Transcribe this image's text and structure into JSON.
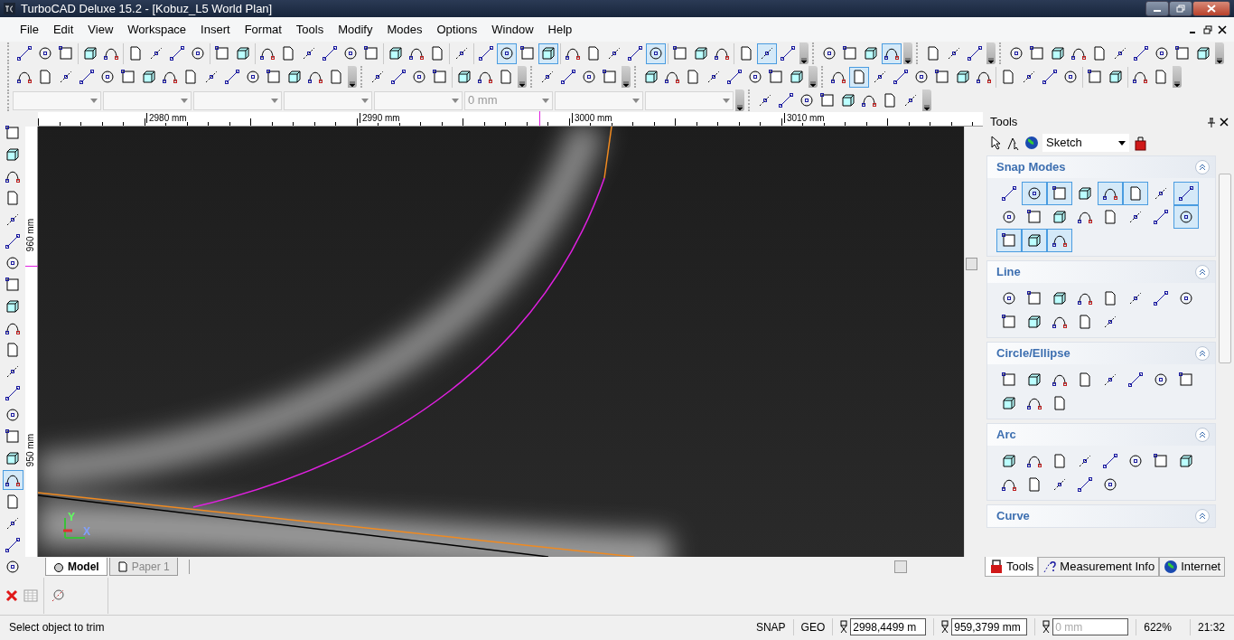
{
  "window": {
    "title": "TurboCAD Deluxe 15.2 - [Kobuz_L5 World Plan]"
  },
  "menu": [
    "File",
    "Edit",
    "View",
    "Workspace",
    "Insert",
    "Format",
    "Tools",
    "Modify",
    "Modes",
    "Options",
    "Window",
    "Help"
  ],
  "toolbar_rows": [
    [
      {
        "groups": [
          [
            {
              "selected": false
            },
            {
              "selected": false
            },
            {
              "selected": false
            }
          ],
          [
            {
              "selected": false
            },
            {
              "selected": false
            }
          ],
          [
            {
              "selected": false
            },
            {
              "selected": false
            },
            {
              "selected": false
            },
            {
              "selected": false
            }
          ],
          [
            {
              "selected": false
            },
            {
              "selected": false
            }
          ],
          [
            {
              "selected": false
            },
            {
              "selected": false
            },
            {
              "selected": false
            },
            {
              "selected": false
            },
            {
              "selected": false
            },
            {
              "selected": false
            }
          ],
          [
            {
              "selected": false
            },
            {
              "selected": false
            },
            {
              "selected": false
            }
          ],
          [
            {
              "selected": false
            }
          ],
          [
            {
              "selected": false
            },
            {
              "selected": true
            },
            {
              "selected": false
            },
            {
              "selected": true
            }
          ],
          [
            {
              "selected": false
            },
            {
              "selected": false
            },
            {
              "selected": false
            },
            {
              "selected": false
            },
            {
              "selected": true
            }
          ],
          [
            {
              "selected": false
            },
            {
              "selected": false
            },
            {
              "selected": false
            }
          ],
          [
            {
              "selected": false
            },
            {
              "selected": true
            },
            {
              "selected": false
            }
          ]
        ]
      },
      {
        "groups": [
          [
            {
              "selected": false
            },
            {
              "selected": false
            },
            {
              "selected": false
            },
            {
              "selected": true
            }
          ]
        ]
      },
      {
        "groups": [
          [
            {
              "selected": false
            },
            {
              "selected": false
            },
            {
              "selected": false
            }
          ]
        ]
      },
      {
        "groups": [
          [
            {
              "selected": false
            },
            {
              "selected": false
            },
            {
              "selected": false
            },
            {
              "selected": false
            },
            {
              "selected": false
            },
            {
              "selected": false
            },
            {
              "selected": false
            },
            {
              "selected": false
            },
            {
              "selected": false
            },
            {
              "selected": false
            }
          ]
        ]
      }
    ],
    [
      {
        "groups": [
          [
            {
              "selected": false
            },
            {
              "selected": false
            },
            {
              "selected": false
            },
            {
              "selected": false
            },
            {
              "selected": false
            },
            {
              "selected": false
            },
            {
              "selected": false
            },
            {
              "selected": false
            },
            {
              "selected": false
            },
            {
              "selected": false
            },
            {
              "selected": false
            },
            {
              "selected": false
            },
            {
              "selected": false
            },
            {
              "selected": false
            },
            {
              "selected": false
            },
            {
              "selected": false
            }
          ]
        ]
      },
      {
        "groups": [
          [
            {
              "selected": false
            },
            {
              "selected": false
            },
            {
              "selected": false
            },
            {
              "selected": false
            }
          ],
          [
            {
              "selected": false
            },
            {
              "selected": false
            },
            {
              "selected": false
            }
          ]
        ]
      },
      {
        "groups": [
          [
            {
              "selected": false
            },
            {
              "selected": false
            },
            {
              "selected": false
            },
            {
              "selected": false
            }
          ]
        ]
      },
      {
        "groups": [
          [
            {
              "selected": false
            },
            {
              "selected": false
            },
            {
              "selected": false
            },
            {
              "selected": false
            },
            {
              "selected": false
            },
            {
              "selected": false
            },
            {
              "selected": false
            },
            {
              "selected": false
            }
          ]
        ]
      },
      {
        "groups": [
          [
            {
              "selected": false
            },
            {
              "selected": true
            },
            {
              "selected": false
            },
            {
              "selected": false
            },
            {
              "selected": false
            },
            {
              "selected": false
            },
            {
              "selected": false
            },
            {
              "selected": false
            }
          ],
          [
            {
              "selected": false
            },
            {
              "selected": false
            },
            {
              "selected": false
            },
            {
              "selected": false
            }
          ],
          [
            {
              "selected": false
            },
            {
              "selected": false
            }
          ],
          [
            {
              "selected": false
            },
            {
              "selected": false
            }
          ]
        ]
      }
    ]
  ],
  "property_bar": {
    "fields": [
      {
        "kind": "empty"
      },
      {
        "kind": "empty"
      },
      {
        "kind": "empty"
      },
      {
        "kind": "empty"
      },
      {
        "kind": "empty"
      },
      {
        "kind": "text",
        "placeholder": "0 mm"
      },
      {
        "kind": "empty"
      },
      {
        "kind": "empty"
      }
    ],
    "snap_toolbar": [
      {
        "selected": false
      },
      {
        "selected": false
      },
      {
        "selected": false
      },
      {
        "selected": false
      },
      {
        "selected": false
      },
      {
        "selected": false
      },
      {
        "selected": false
      },
      {
        "selected": false
      }
    ]
  },
  "left_toolbar": [
    {
      "selected": false
    },
    {
      "selected": false
    },
    {
      "selected": false
    },
    {
      "selected": false
    },
    {
      "selected": false
    },
    {
      "selected": false
    },
    {
      "selected": false
    },
    {
      "selected": false
    },
    {
      "selected": false
    },
    {
      "selected": false
    },
    {
      "selected": false
    },
    {
      "selected": false
    },
    {
      "selected": false
    },
    {
      "selected": false
    },
    {
      "selected": false
    },
    {
      "selected": false
    },
    {
      "selected": true
    },
    {
      "selected": false
    },
    {
      "selected": false
    },
    {
      "selected": false
    },
    {
      "selected": false
    }
  ],
  "axis_labels": [
    "Y",
    "X"
  ],
  "ruler": {
    "top_labels": [
      "2980 mm",
      "2990 mm",
      "3000 mm",
      "3010 mm"
    ],
    "left_labels": [
      "960 mm",
      "950 mm"
    ]
  },
  "sheet_tabs": [
    {
      "label": "Model",
      "selected": true
    },
    {
      "label": "Paper 1",
      "selected": false
    }
  ],
  "tools_panel": {
    "title": "Tools",
    "mode": "Sketch",
    "sections": [
      {
        "title": "Snap Modes",
        "tools": [
          {
            "selected": false
          },
          {
            "selected": true
          },
          {
            "selected": true
          },
          {
            "selected": false
          },
          {
            "selected": true
          },
          {
            "selected": true
          },
          {
            "selected": false
          },
          {
            "selected": true
          },
          {
            "selected": false
          },
          {
            "selected": false
          },
          {
            "selected": false
          },
          {
            "selected": false
          },
          {
            "selected": false
          },
          {
            "selected": false
          },
          {
            "selected": false
          },
          {
            "selected": true
          },
          {
            "selected": true
          },
          {
            "selected": true
          },
          {
            "selected": true
          }
        ]
      },
      {
        "title": "Line",
        "tools": [
          {
            "selected": false
          },
          {
            "selected": false
          },
          {
            "selected": false
          },
          {
            "selected": false
          },
          {
            "selected": false
          },
          {
            "selected": false
          },
          {
            "selected": false
          },
          {
            "selected": false
          },
          {
            "selected": false
          },
          {
            "selected": false
          },
          {
            "selected": false
          },
          {
            "selected": false
          },
          {
            "selected": false
          }
        ]
      },
      {
        "title": "Circle/Ellipse",
        "tools": [
          {
            "selected": false
          },
          {
            "selected": false
          },
          {
            "selected": false
          },
          {
            "selected": false
          },
          {
            "selected": false
          },
          {
            "selected": false
          },
          {
            "selected": false
          },
          {
            "selected": false
          },
          {
            "selected": false
          },
          {
            "selected": false
          },
          {
            "selected": false
          }
        ]
      },
      {
        "title": "Arc",
        "tools": [
          {
            "selected": false
          },
          {
            "selected": false
          },
          {
            "selected": false
          },
          {
            "selected": false
          },
          {
            "selected": false
          },
          {
            "selected": false
          },
          {
            "selected": false
          },
          {
            "selected": false
          },
          {
            "selected": false
          },
          {
            "selected": false
          },
          {
            "selected": false
          },
          {
            "selected": false
          },
          {
            "selected": false
          }
        ]
      },
      {
        "title": "Curve"
      }
    ],
    "tabs": [
      {
        "label": "Tools",
        "selected": true
      },
      {
        "label": "Measurement Info",
        "selected": false
      },
      {
        "label": "Internet",
        "selected": false
      }
    ]
  },
  "status_bar": {
    "message": "Select object to trim",
    "snap": "SNAP",
    "geo": "GEO",
    "x": "2998,4499 m",
    "y": "959,3799 mm",
    "z_placeholder": "0 mm",
    "zoom": "622%",
    "time": "21:32"
  }
}
